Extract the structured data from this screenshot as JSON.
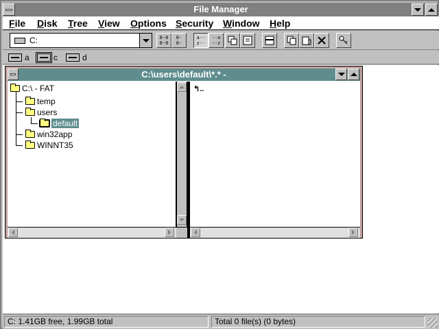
{
  "app": {
    "title": "File Manager"
  },
  "menu": {
    "items": [
      {
        "label": "File",
        "key": "F"
      },
      {
        "label": "Disk",
        "key": "D"
      },
      {
        "label": "Tree",
        "key": "T"
      },
      {
        "label": "View",
        "key": "V"
      },
      {
        "label": "Options",
        "key": "O"
      },
      {
        "label": "Security",
        "key": "S"
      },
      {
        "label": "Window",
        "key": "W"
      },
      {
        "label": "Help",
        "key": "H"
      }
    ]
  },
  "toolbar": {
    "drive_combo_value": "C:",
    "buttons": [
      {
        "name": "connect-network-drive-button",
        "glyph": "0-0-0-0"
      },
      {
        "name": "disconnect-drive-button",
        "glyph": "0--0--"
      },
      {
        "name": "sort-by-name-button",
        "glyph": "a--z--"
      },
      {
        "name": "sort-by-type-button",
        "glyph": "--a--z"
      },
      {
        "name": "view-details-button",
        "glyph": ""
      },
      {
        "name": "view-partial-button",
        "glyph": ""
      },
      {
        "name": "split-window-button",
        "glyph": ""
      },
      {
        "name": "copy-button",
        "glyph": ""
      },
      {
        "name": "paste-button",
        "glyph": ""
      },
      {
        "name": "delete-button",
        "glyph": "✕"
      },
      {
        "name": "properties-button",
        "glyph": ""
      }
    ]
  },
  "drives": [
    {
      "letter": "a",
      "icon": "floppy-drive-icon"
    },
    {
      "letter": "c",
      "icon": "hard-drive-icon",
      "selected": true
    },
    {
      "letter": "d",
      "icon": "cdrom-drive-icon"
    }
  ],
  "child_window": {
    "title": "C:\\users\\default\\*.* -",
    "tree": {
      "root": "C:\\ - FAT",
      "items": [
        {
          "label": "temp",
          "level": 1
        },
        {
          "label": "users",
          "level": 1
        },
        {
          "label": "default",
          "level": 2,
          "selected": true
        },
        {
          "label": "win32app",
          "level": 1
        },
        {
          "label": "WINNT35",
          "level": 1
        }
      ]
    },
    "files": {
      "parent_entry": "↰.."
    }
  },
  "status": {
    "left": "C: 1.41GB free,  1.99GB total",
    "right": "Total 0 file(s) (0 bytes)"
  },
  "colors": {
    "title_active": "#5f8d8d",
    "title_inactive": "#808080",
    "folder": "#ffff80",
    "child_border": "#c0a0a0"
  }
}
